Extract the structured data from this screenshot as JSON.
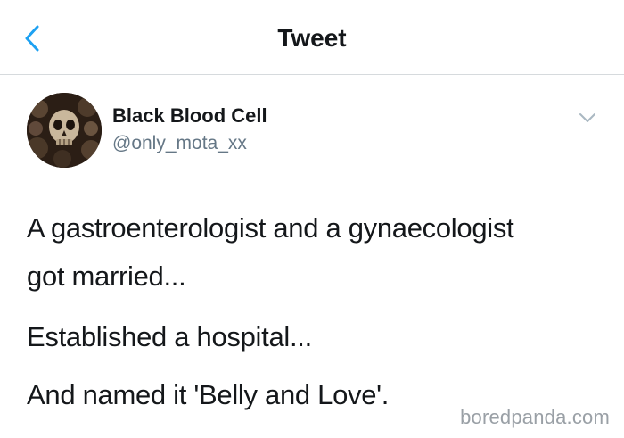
{
  "header": {
    "title": "Tweet",
    "back_icon": "chevron-left-icon",
    "accent_color": "#1da1f2"
  },
  "tweet": {
    "author": {
      "name": "Black Blood Cell",
      "handle": "@only_mota_xx",
      "avatar_icon": "skull-avatar"
    },
    "menu_icon": "chevron-down-icon",
    "text_lines": [
      "A gastroenterologist and a gynaecologist",
      "got married...",
      "Established a hospital...",
      "And named it 'Belly and Love'."
    ]
  },
  "watermark": {
    "text": "boredpanda.com",
    "color": "#9aa0a6"
  }
}
